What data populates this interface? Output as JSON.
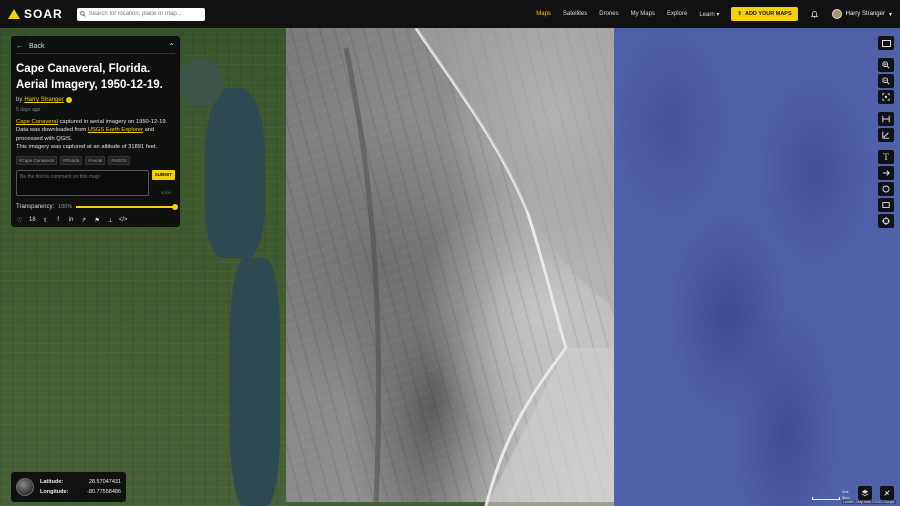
{
  "app": {
    "name": "SOAR"
  },
  "search": {
    "placeholder": "Search for location, place or map..."
  },
  "nav": {
    "items": [
      "Maps",
      "Satellites",
      "Drones",
      "My Maps",
      "Explore",
      "Learn"
    ],
    "active": "Maps",
    "add_button": "ADD YOUR MAPS",
    "user_name": "Harry Stranger"
  },
  "panel": {
    "back_label": "Back",
    "title": "Cape Canaveral, Florida. Aerial Imagery, 1950-12-19.",
    "by_prefix": "by",
    "author": "Harry Stranger",
    "date": "5 days ago",
    "desc_link1": "Cape Canaveral",
    "desc_text1": " captured in aerial imagery on 1950-12-19. Data was downloaded from ",
    "desc_link2": "USGS Earth Explorer",
    "desc_text2": " and processed with QGIS.",
    "desc_line2": "This imagery was captured at an altitude of 31891 feet.",
    "tags": [
      "#Cape Canaveral",
      "#Florida",
      "#Aerial",
      "#USGS"
    ],
    "comment_placeholder": "Be the first to comment on this map!",
    "submit_label": "SUBMIT",
    "char_count": "0/300",
    "transparency_label": "Transparency:",
    "transparency_value": "100%",
    "transparency_fraction": 1.0,
    "likes": "18"
  },
  "coords": {
    "lat_label": "Latitude:",
    "lat_value": "28.57047431",
    "lng_label": "Longitude:",
    "lng_value": "-80.77558486"
  },
  "map": {
    "scale_label": "2mi",
    "scale_label2": "5km",
    "attribution": "Leaflet | Map data ©2022 Google"
  },
  "colors": {
    "accent": "#f5d10a",
    "ocean": "#4f61a8",
    "panel": "#0c0c0c"
  }
}
